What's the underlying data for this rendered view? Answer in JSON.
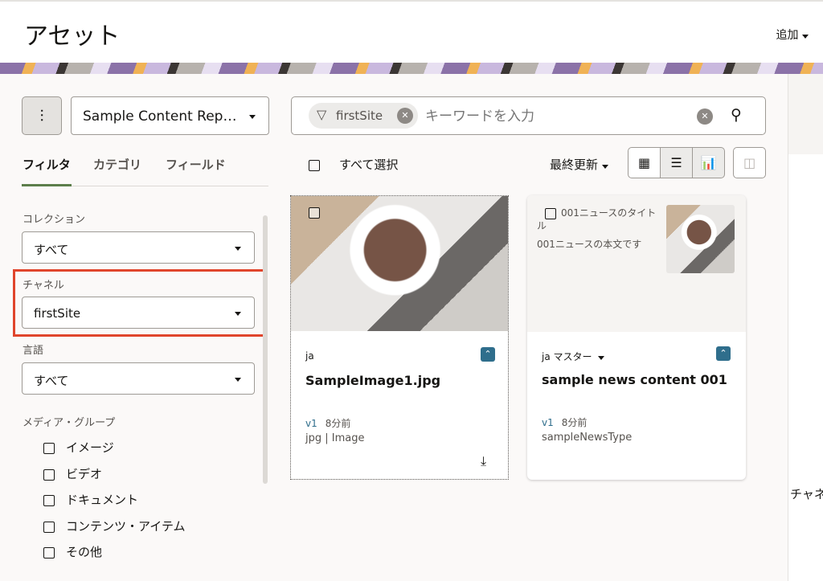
{
  "header": {
    "title": "アセット",
    "add_label": "追加"
  },
  "filter_bar": {
    "repository": "Sample Content Rep…",
    "chip": "firstSite",
    "search_placeholder": "キーワードを入力"
  },
  "tabs": [
    "フィルタ",
    "カテゴリ",
    "フィールド"
  ],
  "filters": {
    "collection_label": "コレクション",
    "collection_value": "すべて",
    "channel_label": "チャネル",
    "channel_value": "firstSite",
    "language_label": "言語",
    "language_value": "すべて",
    "media_label": "メディア・グループ",
    "media": [
      "イメージ",
      "ビデオ",
      "ドキュメント",
      "コンテンツ・アイテム",
      "その他"
    ]
  },
  "toolbar": {
    "select_all": "すべて選択",
    "sort": "最終更新"
  },
  "cards": [
    {
      "lang": "ja",
      "title": "SampleImage1.jpg",
      "version": "v1",
      "time": "8分前",
      "type": "jpg | Image"
    },
    {
      "lang": "ja マスター",
      "title": "sample news content 001",
      "version": "v1",
      "time": "8分前",
      "type": "sampleNewsType",
      "preview_title": "001ニュースのタイトル",
      "preview_body": "001ニュースの本文です"
    }
  ],
  "right_panel": {
    "partial_label": "チャネ"
  },
  "colors": {
    "highlight": "#e0452c",
    "accent": "#2f6e8c",
    "tab_underline": "#5c7e4b"
  }
}
